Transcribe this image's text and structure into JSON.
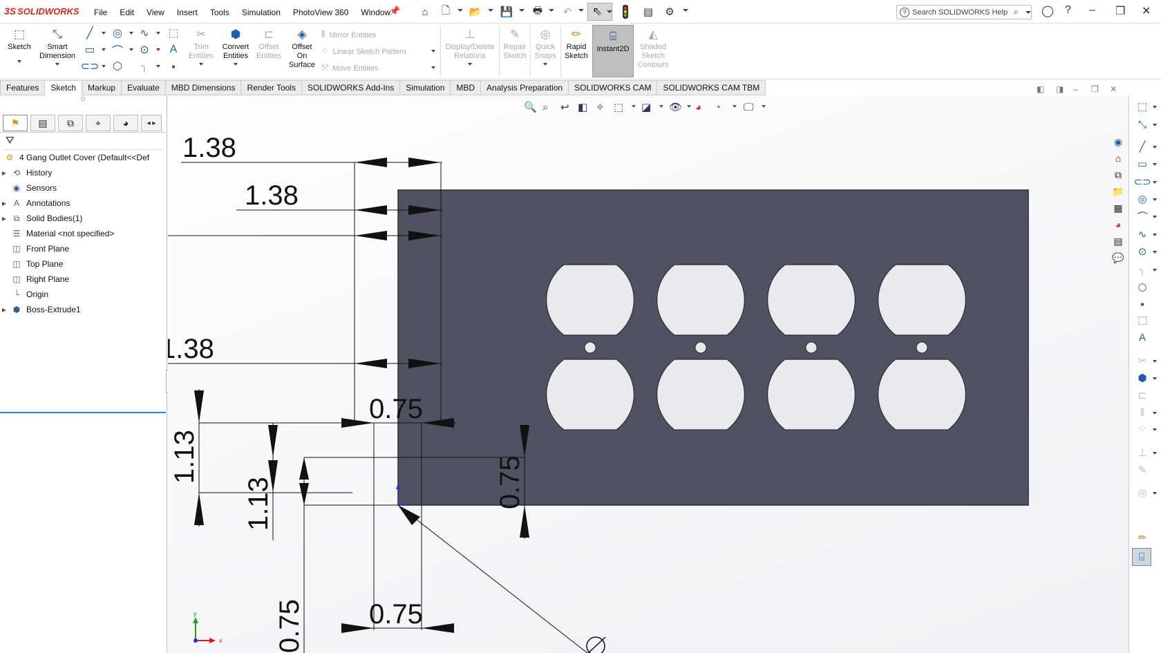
{
  "app": {
    "logo_mark": "3S",
    "logo_text": "SOLIDWORKS"
  },
  "menu": [
    "File",
    "Edit",
    "View",
    "Insert",
    "Tools",
    "Simulation",
    "PhotoView 360",
    "Window"
  ],
  "search": {
    "placeholder": "Search SOLIDWORKS Help"
  },
  "ribbon": {
    "sketch": "Sketch",
    "smart_dimension": [
      "Smart",
      "Dimension"
    ],
    "trim_entities": [
      "Trim",
      "Entities"
    ],
    "convert_entities": [
      "Convert",
      "Entities"
    ],
    "offset_entities": [
      "Offset",
      "Entities"
    ],
    "offset_on_surface": [
      "Offset",
      "On",
      "Surface"
    ],
    "mirror_entities": "Mirror Entities",
    "linear_sketch_pattern": "Linear Sketch Pattern",
    "move_entities": "Move Entities",
    "display_delete_relations": [
      "Display/Delete",
      "Relations"
    ],
    "repair_sketch": [
      "Repair",
      "Sketch"
    ],
    "quick_snaps": [
      "Quick",
      "Snaps"
    ],
    "rapid_sketch": [
      "Rapid",
      "Sketch"
    ],
    "instant2d": "Instant2D",
    "shaded_sketch_contours": [
      "Shaded",
      "Sketch",
      "Contours"
    ]
  },
  "tabs": [
    "Features",
    "Sketch",
    "Markup",
    "Evaluate",
    "MBD Dimensions",
    "Render Tools",
    "SOLIDWORKS Add-Ins",
    "Simulation",
    "MBD",
    "Analysis Preparation",
    "SOLIDWORKS CAM",
    "SOLIDWORKS CAM TBM"
  ],
  "active_tab": "Sketch",
  "feature_tree": {
    "root": "4 Gang Outlet Cover  (Default<<Def",
    "items": [
      {
        "label": "History",
        "expandable": true,
        "icon": "history-icon"
      },
      {
        "label": "Sensors",
        "expandable": false,
        "icon": "sensors-icon"
      },
      {
        "label": "Annotations",
        "expandable": true,
        "icon": "annotations-icon"
      },
      {
        "label": "Solid Bodies(1)",
        "expandable": true,
        "icon": "solid-bodies-icon"
      },
      {
        "label": "Material <not specified>",
        "expandable": false,
        "icon": "material-icon"
      },
      {
        "label": "Front Plane",
        "expandable": false,
        "icon": "plane-icon"
      },
      {
        "label": "Top Plane",
        "expandable": false,
        "icon": "plane-icon"
      },
      {
        "label": "Right Plane",
        "expandable": false,
        "icon": "plane-icon"
      },
      {
        "label": "Origin",
        "expandable": false,
        "icon": "origin-icon"
      },
      {
        "label": "Boss-Extrude1",
        "expandable": true,
        "icon": "extrude-icon"
      }
    ]
  },
  "dimensions": {
    "top_a": "1.38",
    "top_b": "1.38",
    "mid": "1.38",
    "horiz_upper": "0.75",
    "horiz_lower": "0.75",
    "vert_left_a": "1.13",
    "vert_left_b": "1.13",
    "vert_right": "0.75",
    "vert_bottom": "0.75"
  },
  "model": {
    "plate_color": "#4e5261",
    "outlet_count": 4
  },
  "triad": {
    "x": "x",
    "y": "y"
  },
  "colors": {
    "accent": "#d52b1e",
    "selection": "#2f7fd6"
  }
}
